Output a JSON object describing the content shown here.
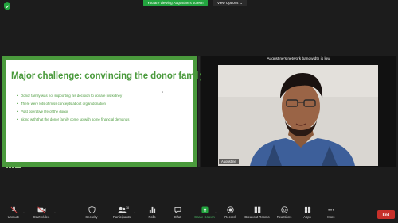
{
  "top_bar": {
    "share_banner": "You are viewing Augustine's screen",
    "view_options": "View Options"
  },
  "slide": {
    "title": "Major challenge: convincing the donor family",
    "bullets": [
      "Donor family was not supporting his decision to donate his kidney",
      "There were lots of miss concepts about organ donation",
      "Post operative life of the donor",
      "along with that the donor family come up with some financial demands"
    ]
  },
  "video": {
    "bandwidth_note": "Augustine's network bandwidth is low",
    "name_tag": "Augustine"
  },
  "toolbar": {
    "unmute": "Unmute",
    "start_video": "Start Video",
    "security": "Security",
    "participants": "Participants",
    "participants_count": "38",
    "polls": "Polls",
    "chat": "Chat",
    "share_screen": "Share Screen",
    "record": "Record",
    "breakout_rooms": "Breakout Rooms",
    "reactions": "Reactions",
    "apps": "Apps",
    "more": "More",
    "end": "End"
  },
  "colors": {
    "slide_green": "#4a9a3c",
    "share_green": "#23a53f",
    "end_red": "#c7302a"
  }
}
